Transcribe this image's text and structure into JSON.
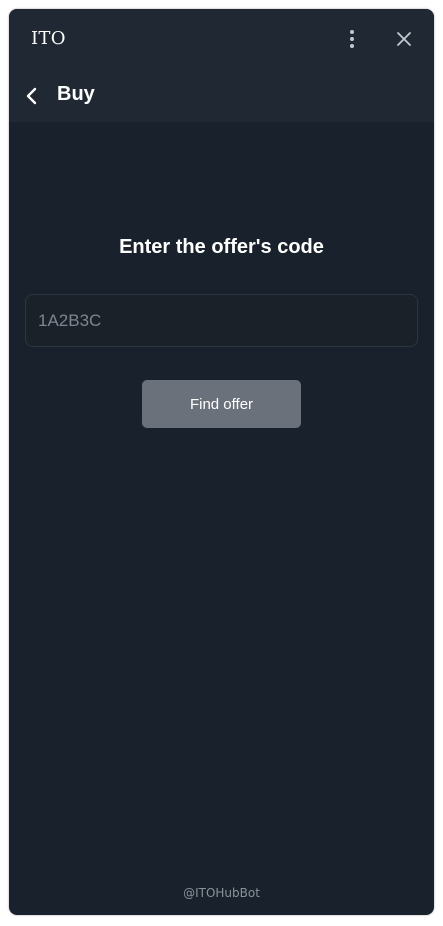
{
  "window": {
    "title": "ITO",
    "more_icon": "vertical-dots-icon",
    "close_icon": "close-icon"
  },
  "nav": {
    "back_icon": "chevron-left-icon",
    "title": "Buy"
  },
  "main": {
    "heading": "Enter the offer's code",
    "code_input": {
      "value": "",
      "placeholder": "1A2B3C"
    },
    "find_button_label": "Find offer"
  },
  "footer": {
    "bot_handle": "@ITOHubBot"
  },
  "colors": {
    "background": "#19222c",
    "header": "#1f2833",
    "button": "#6b717b",
    "text": "#ffffff",
    "muted_text": "#8a9199"
  }
}
